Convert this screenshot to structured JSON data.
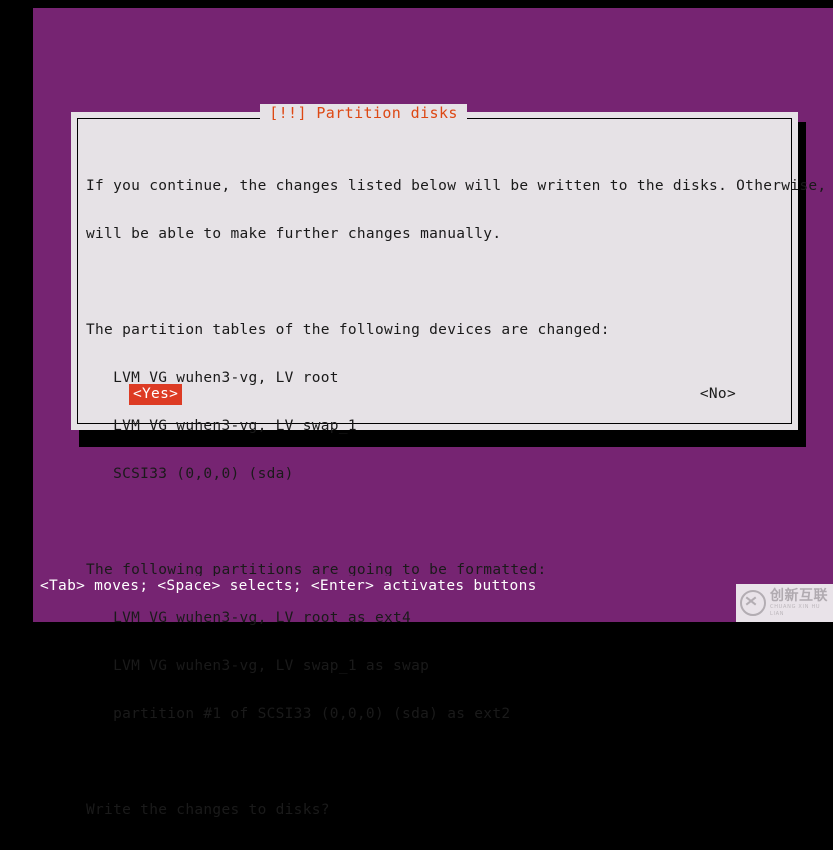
{
  "colors": {
    "screen_border": "#000000",
    "terminal_background": "#762472",
    "dialog_background": "#e6e2e6",
    "dialog_border": "#000000",
    "dialog_shadow": "#000000",
    "title_text": "#dd4814",
    "body_text": "#1a1a1a",
    "selected_button_background": "#dd3b24",
    "selected_button_text": "#ffffff",
    "status_bar_background": "#762472",
    "status_bar_text": "#ffffff"
  },
  "dialog": {
    "title": "[!!] Partition disks",
    "lines": [
      "If you continue, the changes listed below will be written to the disks. Otherwise, you",
      "will be able to make further changes manually.",
      "",
      "The partition tables of the following devices are changed:",
      "   LVM VG wuhen3-vg, LV root",
      "   LVM VG wuhen3-vg, LV swap_1",
      "   SCSI33 (0,0,0) (sda)",
      "",
      "The following partitions are going to be formatted:",
      "   LVM VG wuhen3-vg, LV root as ext4",
      "   LVM VG wuhen3-vg, LV swap_1 as swap",
      "   partition #1 of SCSI33 (0,0,0) (sda) as ext2",
      "",
      "Write the changes to disks?"
    ],
    "intro": {
      "line1": "If you continue, the changes listed below will be written to the disks. Otherwise, you",
      "line2": "will be able to make further changes manually."
    },
    "changed_devices": {
      "heading": "The partition tables of the following devices are changed:",
      "items": [
        "   LVM VG wuhen3-vg, LV root",
        "   LVM VG wuhen3-vg, LV swap_1",
        "   SCSI33 (0,0,0) (sda)"
      ]
    },
    "formatted_partitions": {
      "heading": "The following partitions are going to be formatted:",
      "items": [
        "   LVM VG wuhen3-vg, LV root as ext4",
        "   LVM VG wuhen3-vg, LV swap_1 as swap",
        "   partition #1 of SCSI33 (0,0,0) (sda) as ext2"
      ]
    },
    "question": "Write the changes to disks?",
    "buttons": {
      "yes": {
        "label": "<Yes>",
        "selected": true
      },
      "no": {
        "label": "<No>",
        "selected": false
      }
    }
  },
  "status_bar": {
    "text": "<Tab> moves; <Space> selects; <Enter> activates buttons"
  },
  "watermark": {
    "chinese": "创新互联",
    "pinyin": "CHUANG XIN HU LIAN",
    "mark": "circle-x-logo"
  }
}
